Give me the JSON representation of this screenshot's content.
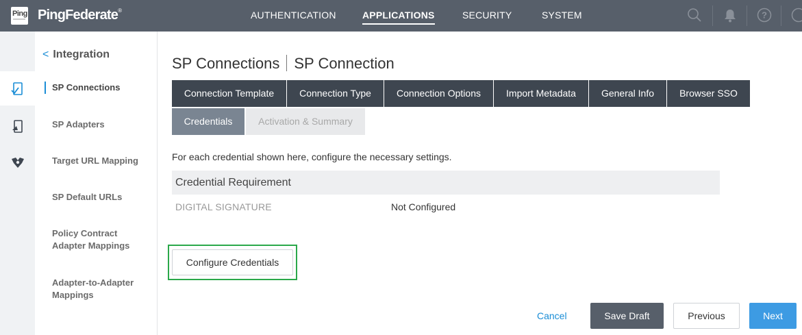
{
  "app": {
    "logo_text": "Ping",
    "brand": "PingFederate",
    "brand_mark": "®"
  },
  "topnav": [
    {
      "label": "AUTHENTICATION",
      "active": false
    },
    {
      "label": "APPLICATIONS",
      "active": true
    },
    {
      "label": "SECURITY",
      "active": false
    },
    {
      "label": "SYSTEM",
      "active": false
    }
  ],
  "topbar_icons": [
    "search-icon",
    "bell-icon",
    "help-icon",
    "user-icon"
  ],
  "rail": [
    "sp-connections-icon",
    "sp-adapters-icon",
    "integration-icon"
  ],
  "sidebar": {
    "back_label": "Integration",
    "items": [
      {
        "label": "SP Connections",
        "active": true
      },
      {
        "label": "SP Adapters",
        "active": false
      },
      {
        "label": "Target URL Mapping",
        "active": false
      },
      {
        "label": "SP Default URLs",
        "active": false
      },
      {
        "label": "Policy Contract Adapter Mappings",
        "active": false
      },
      {
        "label": "Adapter-to-Adapter Mappings",
        "active": false
      }
    ]
  },
  "breadcrumb": {
    "parent": "SP Connections",
    "current": "SP Connection"
  },
  "tabs_row1": [
    "Connection Template",
    "Connection Type",
    "Connection Options",
    "Import Metadata",
    "General Info",
    "Browser SSO"
  ],
  "tabs_row2": [
    {
      "label": "Credentials",
      "state": "current"
    },
    {
      "label": "Activation & Summary",
      "state": "disabled"
    }
  ],
  "content": {
    "description": "For each credential shown here, configure the necessary settings.",
    "table_header": "Credential Requirement",
    "rows": [
      {
        "label": "DIGITAL SIGNATURE",
        "value": "Not Configured"
      }
    ],
    "configure_button": "Configure Credentials"
  },
  "footer": {
    "cancel": "Cancel",
    "save_draft": "Save Draft",
    "previous": "Previous",
    "next": "Next"
  },
  "colors": {
    "topbar": "#575f6a",
    "tab_dark": "#3e4650",
    "tab_current": "#7a8592",
    "accent": "#1a8dd6",
    "next_button": "#3d9be3",
    "highlight": "#2aa84a"
  }
}
